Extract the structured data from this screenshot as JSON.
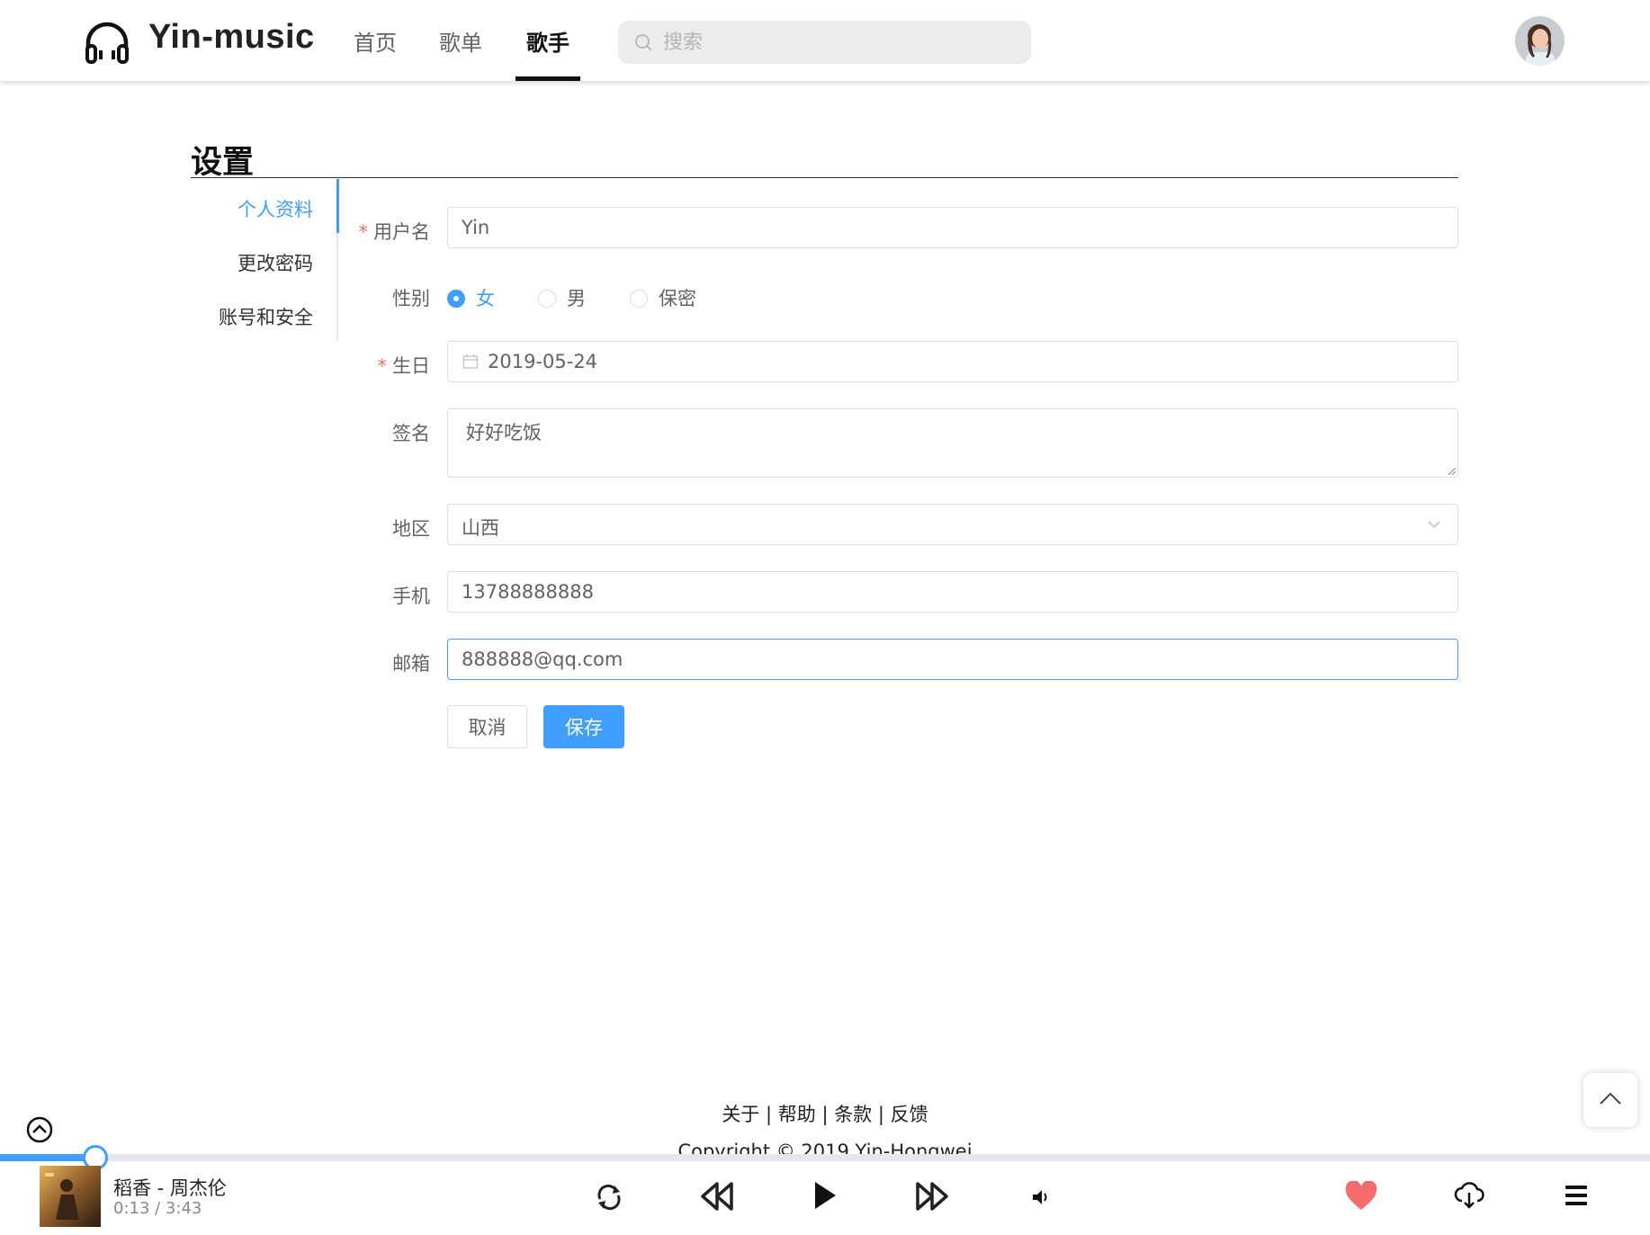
{
  "header": {
    "brand": "Yin-music",
    "nav": [
      {
        "label": "首页"
      },
      {
        "label": "歌单"
      },
      {
        "label": "歌手"
      }
    ],
    "search_placeholder": "搜索"
  },
  "settings": {
    "title": "设置",
    "menu": [
      {
        "label": "个人资料"
      },
      {
        "label": "更改密码"
      },
      {
        "label": "账号和安全"
      }
    ],
    "form": {
      "required_mark": "*",
      "username_label": "用户名",
      "username_value": "Yin",
      "gender_label": "性别",
      "gender_options": [
        "女",
        "男",
        "保密"
      ],
      "gender_selected": "女",
      "birthday_label": "生日",
      "birthday_value": "2019-05-24",
      "signature_label": "签名",
      "signature_value": "好好吃饭",
      "region_label": "地区",
      "region_value": "山西",
      "phone_label": "手机",
      "phone_value": "13788888888",
      "email_label": "邮箱",
      "email_value": "888888@qq.com",
      "cancel_label": "取消",
      "save_label": "保存"
    }
  },
  "footer": {
    "links": [
      "关于",
      "帮助",
      "条款",
      "反馈"
    ],
    "separator": "|",
    "copyright": "Copyright © 2019 Yin-Hongwei"
  },
  "player": {
    "song": "稻香 - 周杰伦",
    "time": "0:13 / 3:43",
    "progress": 0.058,
    "accent": "#409eff",
    "like_color": "#f56c6c"
  },
  "icons": [
    "headphones-icon",
    "search-icon",
    "calendar-icon",
    "chevron-down-icon",
    "chevron-up-icon",
    "loop-icon",
    "previous-icon",
    "play-icon",
    "next-icon",
    "volume-icon",
    "heart-icon",
    "download-icon",
    "playlist-icon"
  ]
}
